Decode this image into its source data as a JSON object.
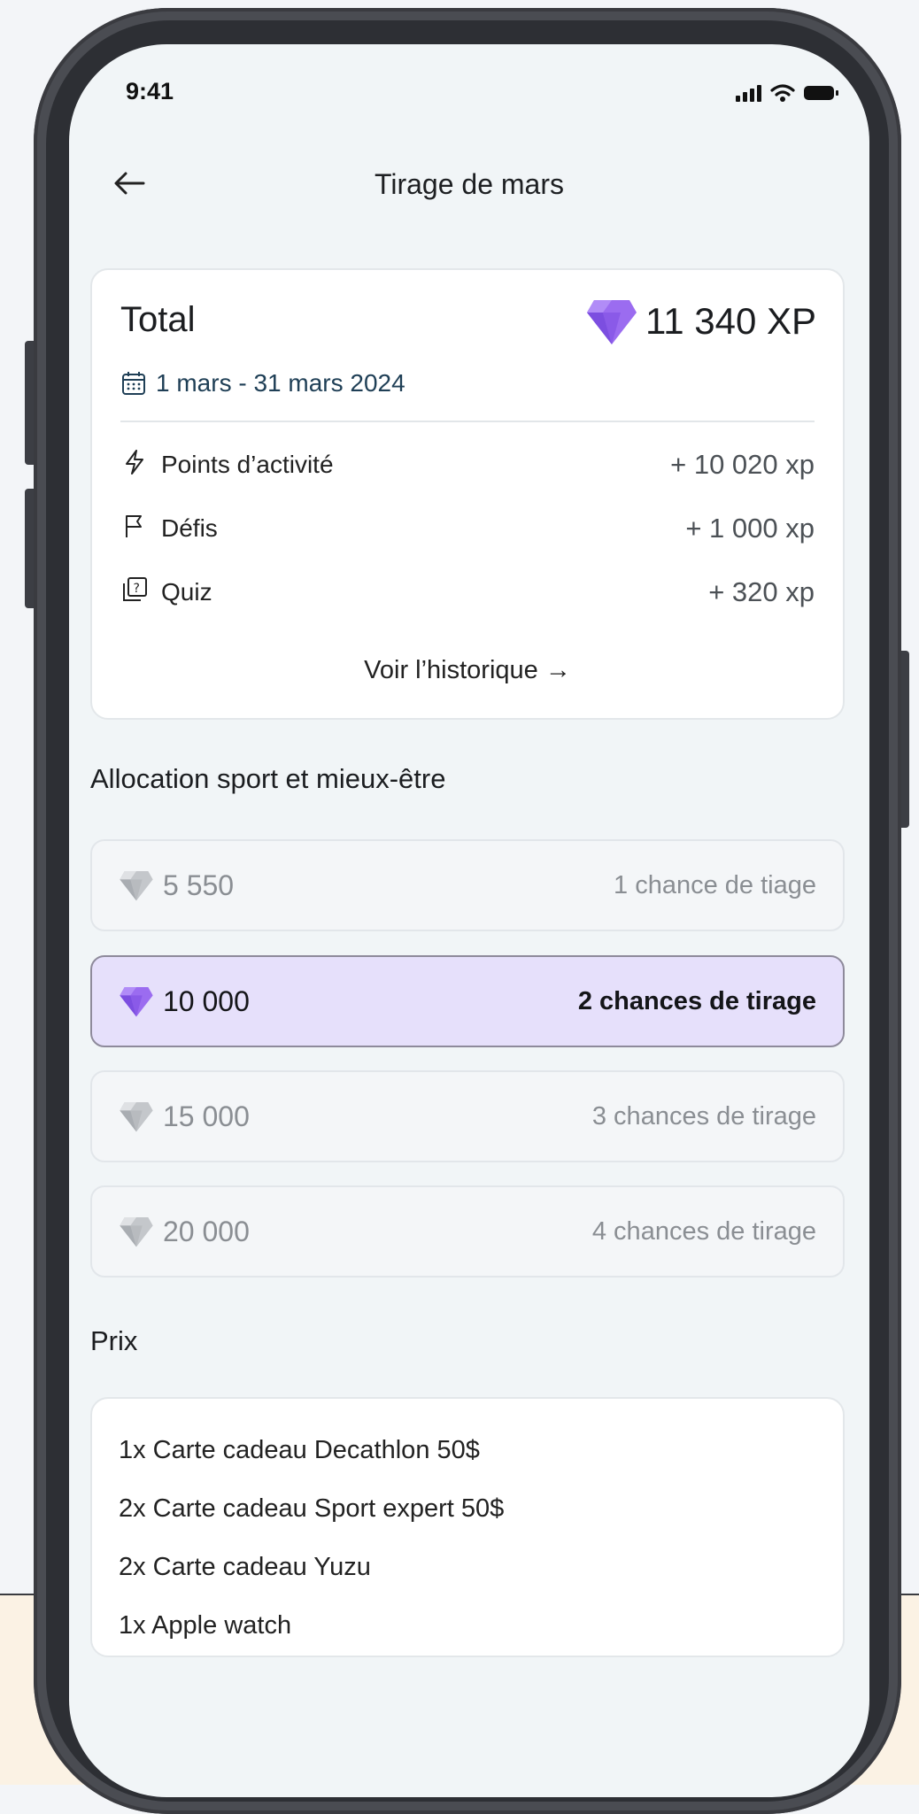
{
  "status_bar": {
    "time": "9:41"
  },
  "header": {
    "title": "Tirage de mars"
  },
  "summary": {
    "total_label": "Total",
    "total_xp": "11 340 XP",
    "date_range": "1 mars - 31 mars 2024",
    "stats": [
      {
        "icon": "lightning-icon",
        "label": "Points d’activité",
        "value": "+ 10 020 xp"
      },
      {
        "icon": "flag-icon",
        "label": "Défis",
        "value": "+ 1 000 xp"
      },
      {
        "icon": "quiz-icon",
        "label": "Quiz",
        "value": "+ 320 xp"
      }
    ],
    "history_link": "Voir l’historique →"
  },
  "allocation": {
    "title": "Allocation sport et mieux-être",
    "tiers": [
      {
        "amount": "5 550",
        "chances": "1 chance de tiage",
        "selected": false
      },
      {
        "amount": "10 000",
        "chances": "2 chances de tirage",
        "selected": true
      },
      {
        "amount": "15 000",
        "chances": "3 chances de tirage",
        "selected": false
      },
      {
        "amount": "20 000",
        "chances": "4 chances de tirage",
        "selected": false
      }
    ]
  },
  "prizes": {
    "title": "Prix",
    "items": [
      "1x Carte cadeau Decathlon 50$",
      "2x Carte cadeau Sport expert 50$",
      "2x Carte cadeau Yuzu",
      "1x Apple watch"
    ]
  },
  "colors": {
    "accent_purple": "#8b5ce6",
    "selected_background": "#e6e0fb",
    "date_text": "#1f3f56"
  }
}
